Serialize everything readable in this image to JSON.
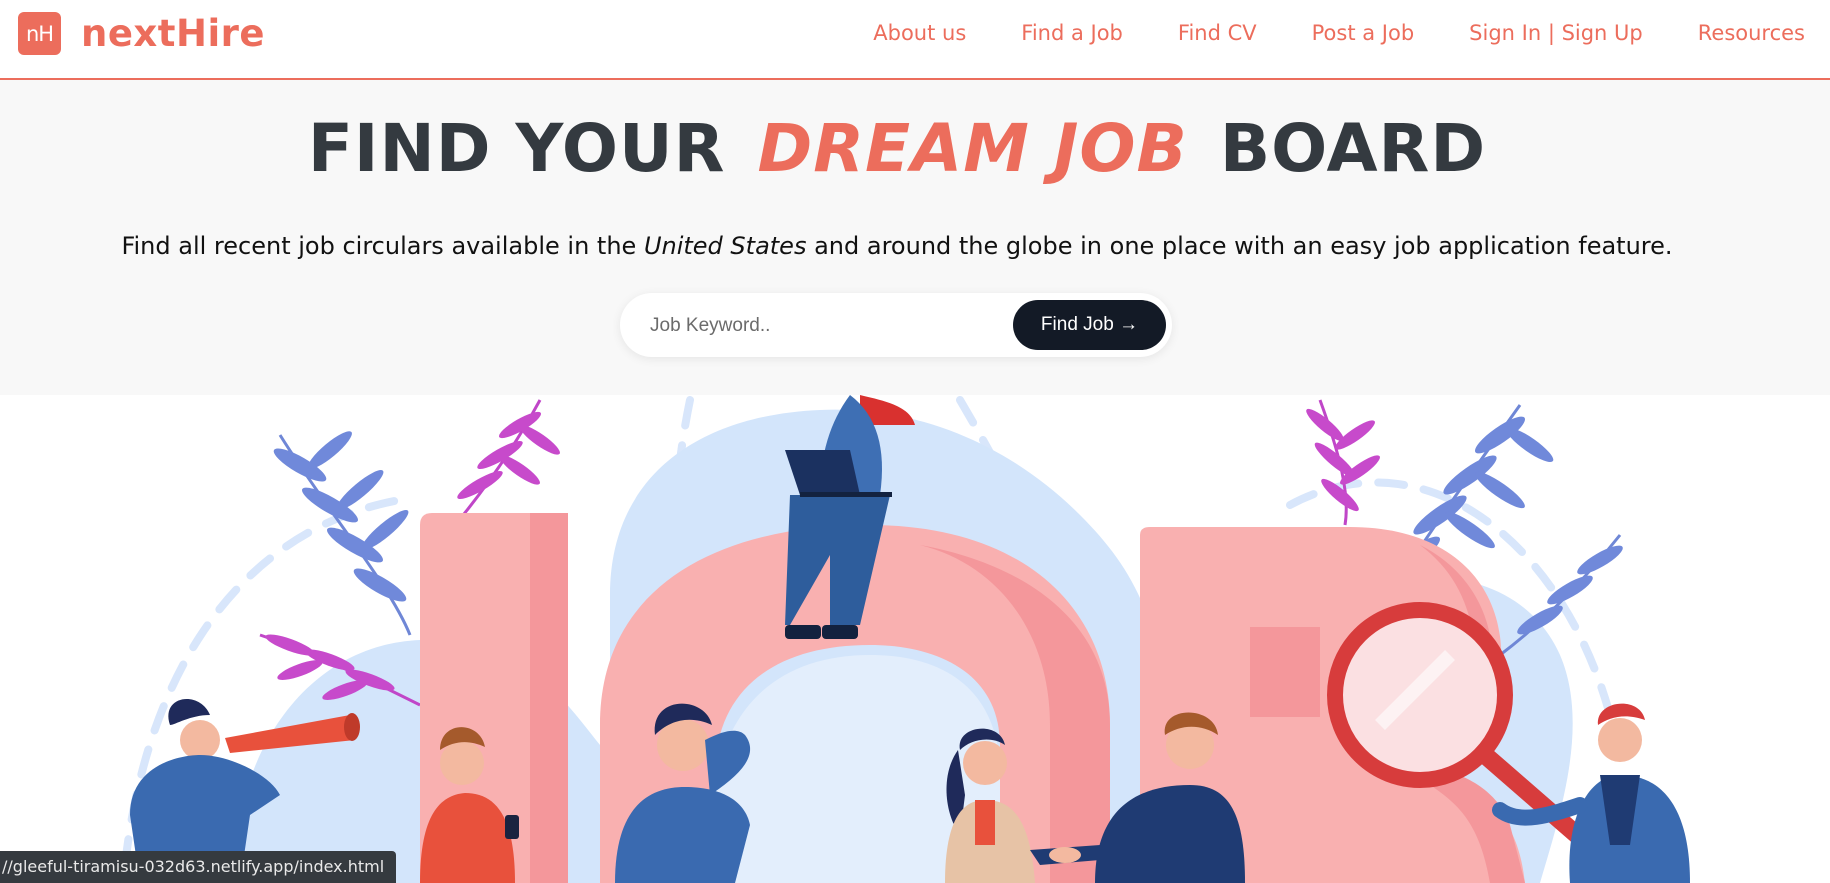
{
  "brand": {
    "logo_mark": "nH",
    "name": "nextHire"
  },
  "nav": {
    "items": [
      {
        "label": "About us"
      },
      {
        "label": "Find a Job"
      },
      {
        "label": "Find CV"
      },
      {
        "label": "Post a Job"
      },
      {
        "label": "Sign In | Sign Up"
      },
      {
        "label": "Resources"
      }
    ]
  },
  "hero": {
    "title_pre": "FIND YOUR",
    "title_accent": "DREAM JOB",
    "title_post": "BOARD",
    "subtitle_pre": "Find all recent job circulars available in the",
    "subtitle_em": "United States",
    "subtitle_post": "and around the globe in one place with an easy job application feature."
  },
  "search": {
    "placeholder": "Job Keyword..",
    "value": "",
    "button_label": "Find Job →"
  },
  "status_bar": {
    "url": "//gleeful-tiramisu-032d63.netlify.app/index.html"
  },
  "colors": {
    "brand": "#ec6d5c",
    "heading": "#343a40",
    "button": "#131a26",
    "hero_bg": "#f8f8f8",
    "letters": "#f9b0b0",
    "blob": "#d3e5fb"
  },
  "illustration": {
    "depicts": "the letters JOB with job seekers and plants"
  }
}
